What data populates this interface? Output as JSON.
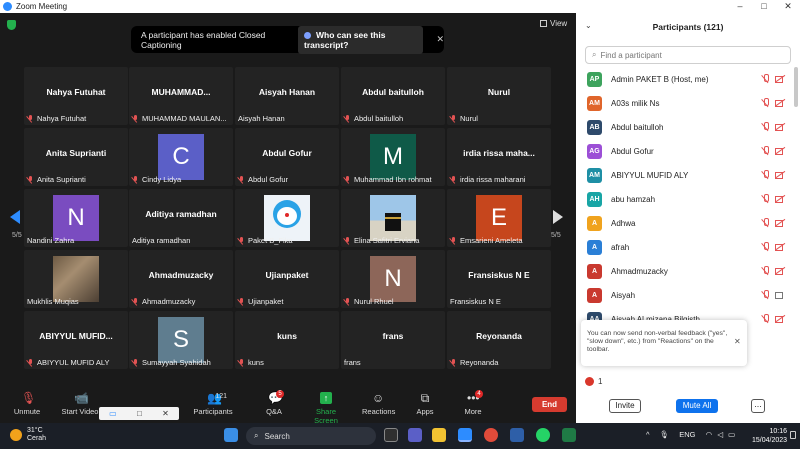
{
  "window": {
    "title": "Zoom Meeting",
    "minimize": "–",
    "maximize": "□",
    "close": "✕"
  },
  "meeting": {
    "view_label": "View",
    "cc_banner": {
      "text": "A participant has enabled Closed Captioning",
      "link": "Who can see this transcript?",
      "close": "✕"
    },
    "page_left": "5/5",
    "page_right": "5/5",
    "tiles": [
      {
        "name": "Nahya Futuhat",
        "big": "Nahya Futuhat",
        "kind": "text"
      },
      {
        "name": "MUHAMMAD MAULAN...",
        "big": "MUHAMMAD...",
        "kind": "text"
      },
      {
        "name": "Aisyah Hanan",
        "big": "Aisyah Hanan",
        "kind": "text",
        "no_mic": true
      },
      {
        "name": "Abdul baitulloh",
        "big": "Abdul baitulloh",
        "kind": "text"
      },
      {
        "name": "Nurul",
        "big": "Nurul",
        "kind": "text"
      },
      {
        "name": "Anita Suprianti",
        "big": "Anita Suprianti",
        "kind": "text"
      },
      {
        "name": "Cindy Lidya",
        "letter": "C",
        "color": "#5b5fc7",
        "kind": "avatar"
      },
      {
        "name": "Abdul Gofur",
        "big": "Abdul Gofur",
        "kind": "text"
      },
      {
        "name": "Muhammad Ibn rohmat",
        "letter": "M",
        "color": "#0f5a48",
        "kind": "avatar"
      },
      {
        "name": "irdia rissa maharani",
        "big": "irdia rissa maha...",
        "kind": "text"
      },
      {
        "name": "Nandini Zahra",
        "letter": "N",
        "color": "#7a4cc0",
        "kind": "avatar",
        "no_mic": true
      },
      {
        "name": "Aditiya ramadhan",
        "big": "Aditiya ramadhan",
        "kind": "text",
        "no_mic": true
      },
      {
        "name": "Paket B_Fika",
        "kind": "photo",
        "photo": "doraemon"
      },
      {
        "name": "Elina Safitri Erviana",
        "kind": "photo",
        "photo": "kaaba"
      },
      {
        "name": "Emsarieni Ameleta",
        "letter": "E",
        "color": "#c6461d",
        "kind": "avatar"
      },
      {
        "name": "Mukhlis Muqias",
        "kind": "photo",
        "photo": "crowd",
        "no_mic": true
      },
      {
        "name": "Ahmadmuzacky",
        "big": "Ahmadmuzacky",
        "kind": "text"
      },
      {
        "name": "Ujianpaket",
        "big": "Ujianpaket",
        "kind": "text"
      },
      {
        "name": "Nurul Rhuel",
        "letter": "N",
        "color": "#8d6659",
        "kind": "avatar"
      },
      {
        "name": "Fransiskus N E",
        "big": "Fransiskus N E",
        "kind": "text",
        "no_mic": true
      },
      {
        "name": "ABIYYUL MUFID ALY",
        "big": "ABIYYUL MUFID...",
        "kind": "text"
      },
      {
        "name": "Sumayyah Syahidah",
        "letter": "S",
        "color": "#5f7d8f",
        "kind": "avatar"
      },
      {
        "name": "kuns",
        "big": "kuns",
        "kind": "text"
      },
      {
        "name": "frans",
        "big": "frans",
        "kind": "text",
        "no_mic": true
      },
      {
        "name": "Reyonanda",
        "big": "Reyonanda",
        "kind": "text"
      }
    ]
  },
  "toolbar": {
    "unmute": "Unmute",
    "start_video": "Start Video",
    "participants": "Participants",
    "participants_count": "121",
    "qa": "Q&A",
    "qa_badge": "5",
    "share": "Share Screen",
    "reactions": "Reactions",
    "apps": "Apps",
    "more": "More",
    "more_badge": "4",
    "end": "End"
  },
  "panel": {
    "title": "Participants (121)",
    "search_placeholder": "Find a participant",
    "participants": [
      {
        "initials": "AP",
        "name": "Admin PAKET B (Host, me)",
        "color": "#3da35d"
      },
      {
        "initials": "AM",
        "name": "A03s milik Ns",
        "color": "#e0652b"
      },
      {
        "initials": "AB",
        "name": "Abdul baitulloh",
        "color": "#2e4a6b"
      },
      {
        "initials": "AG",
        "name": "Abdul Gofur",
        "color": "#9c4fd6"
      },
      {
        "initials": "AM",
        "name": "ABIYYUL MUFID ALY",
        "color": "#1e8fa5"
      },
      {
        "initials": "AH",
        "name": "abu hamzah",
        "color": "#18a5a5"
      },
      {
        "initials": "A",
        "name": "Adhwa",
        "color": "#f0a31e"
      },
      {
        "initials": "A",
        "name": "afrah",
        "color": "#2a7fd6"
      },
      {
        "initials": "A",
        "name": "Ahmadmuzacky",
        "color": "#c9392f"
      },
      {
        "initials": "A",
        "name": "Aisyah",
        "color": "#c9392f",
        "video_on": true
      },
      {
        "initials": "AA",
        "name": "Aisyah Al mizana Bilqisth",
        "color": "#2e4a6b"
      }
    ],
    "tip": "You can now send non-verbal feedback (\"yes\", \"slow down\", etc.) from \"Reactions\" on the toolbar.",
    "tip_close": "✕",
    "hand_count": "1",
    "invite": "Invite",
    "mute_all": "Mute All",
    "more": "..."
  },
  "taskbar": {
    "temperature": "31°C",
    "weather": "Cerah",
    "search": "Search",
    "language": "ENG",
    "time": "10:16",
    "date": "15/04/2023"
  }
}
